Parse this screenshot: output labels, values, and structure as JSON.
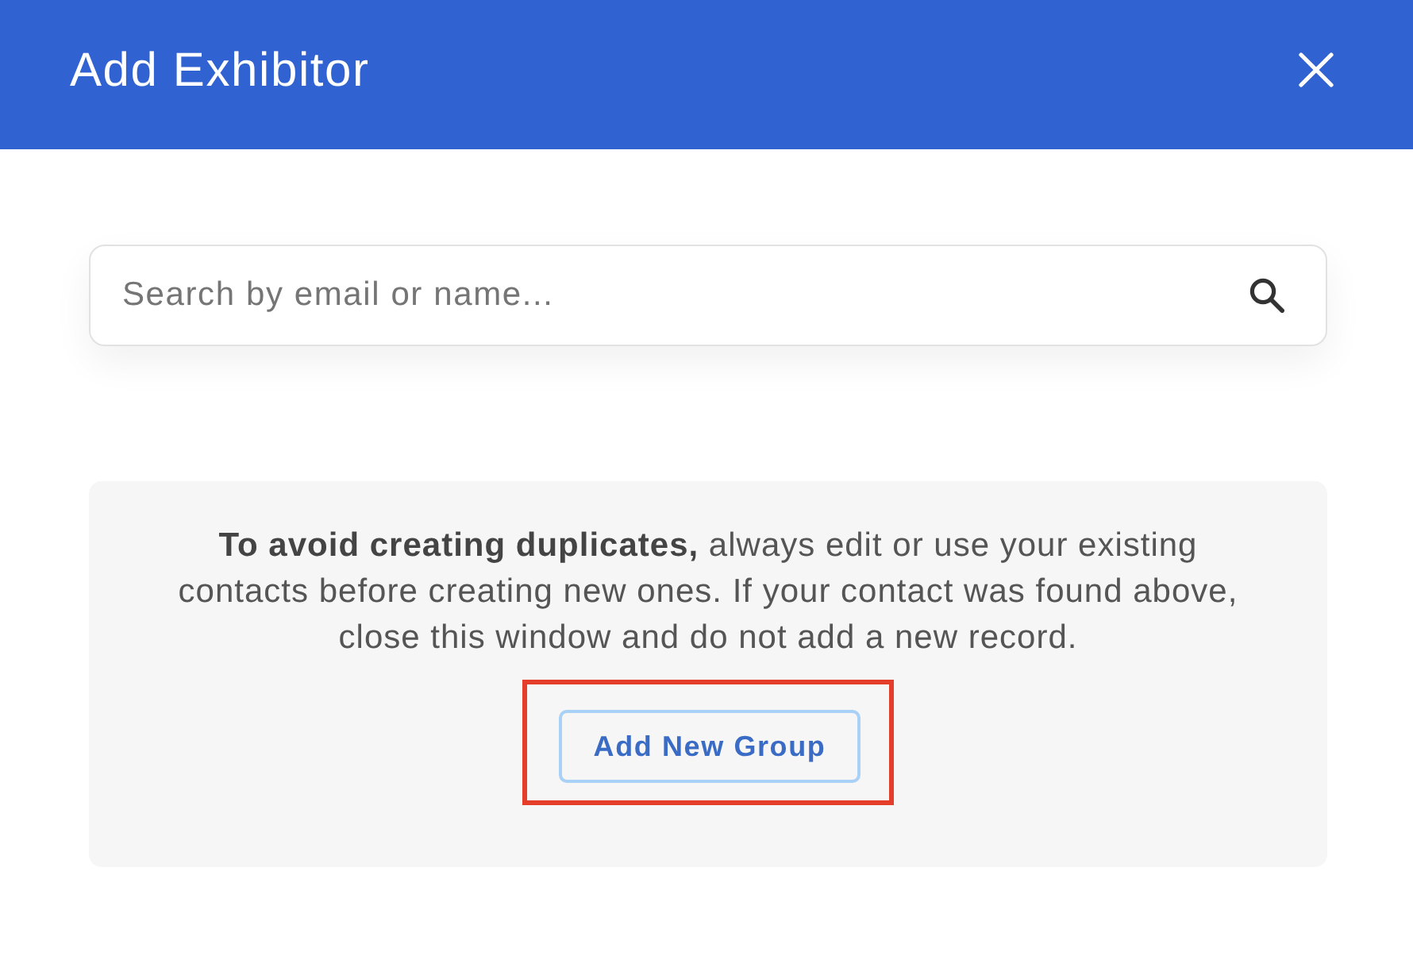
{
  "dialog": {
    "title": "Add Exhibitor"
  },
  "search": {
    "placeholder": "Search by email or name..."
  },
  "notice": {
    "text": "**To avoid creating duplicates,** always edit or use your existing contacts before creating new ones. If your contact was found above, close this window and do not add a new record."
  },
  "button": {
    "label": "Add New Group",
    "highlighted": true
  }
}
